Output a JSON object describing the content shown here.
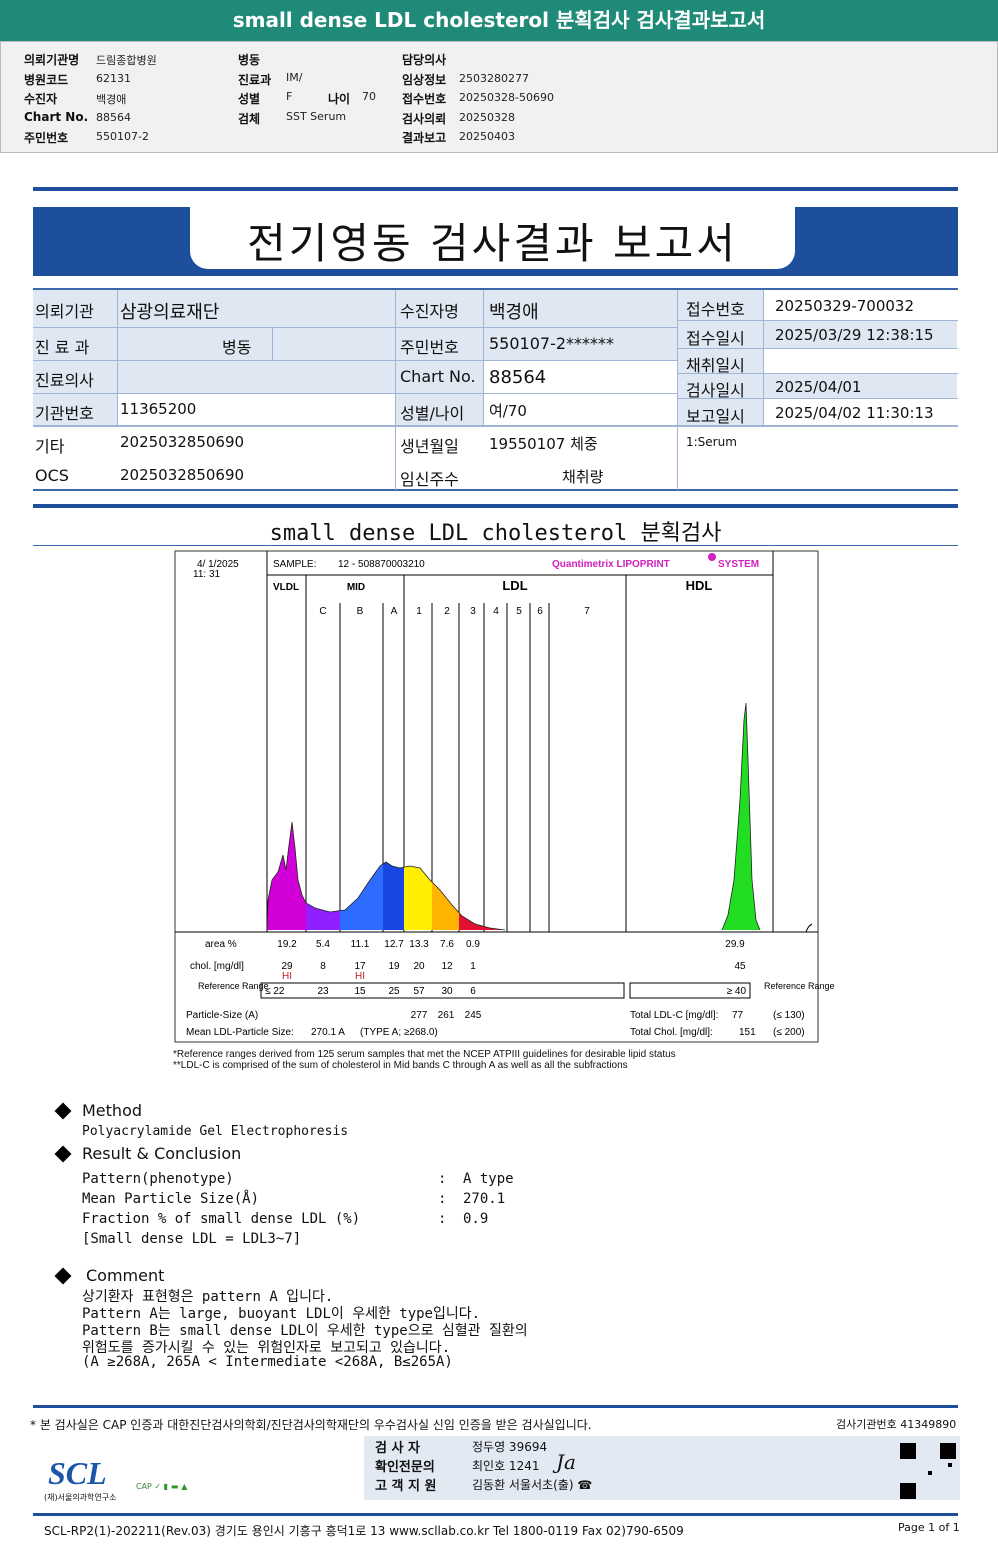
{
  "top_title": "small dense LDL cholesterol 분획검사 검사결과보고서",
  "header": {
    "col1": [
      {
        "k": "의뢰기관명",
        "v": "드림종합병원"
      },
      {
        "k": "병원코드",
        "v": "62131"
      },
      {
        "k": "수진자",
        "v": "백경애"
      },
      {
        "k": "Chart No.",
        "v": "88564"
      },
      {
        "k": "주민번호",
        "v": "550107-2"
      }
    ],
    "col2": [
      {
        "k": "병동",
        "v": ""
      },
      {
        "k": "진료과",
        "v": "IM/"
      },
      {
        "k": "성별",
        "v": "F"
      },
      {
        "k": "검체",
        "v": "SST Serum"
      }
    ],
    "age_label": "나이",
    "age": "70",
    "col3": [
      {
        "k": "담당의사",
        "v": ""
      },
      {
        "k": "임상정보",
        "v": "2503280277"
      },
      {
        "k": "접수번호",
        "v": "20250328-50690"
      },
      {
        "k": "검사의뢰",
        "v": "20250328"
      },
      {
        "k": "결과보고",
        "v": "20250403"
      }
    ]
  },
  "banner_title": "전기영동 검사결과 보고서",
  "info": {
    "l1": "의뢰기관",
    "v1": "삼광의료재단",
    "l2": "수진자명",
    "v2": "백경애",
    "l3": "진 료 과",
    "v3": "병동",
    "l4": "주민번호",
    "v4": "550107-2******",
    "l5": "진료의사",
    "v5": "",
    "l6": "Chart No.",
    "v6": "88564",
    "l7": "기관번호",
    "v7": "11365200",
    "l8": "성별/나이",
    "v8": "여/70",
    "l9": "기타",
    "v9": "2025032850690",
    "l10": "생년월일",
    "v10": "19550107 체중",
    "l11": "OCS",
    "v11": "2025032850690",
    "l12": "임신주수",
    "v12": "채취량",
    "r": [
      {
        "k": "접수번호",
        "v": "20250329-700032"
      },
      {
        "k": "접수일시",
        "v": "2025/03/29 12:38:15"
      },
      {
        "k": "채취일시",
        "v": ""
      },
      {
        "k": "검사일시",
        "v": "2025/04/01"
      },
      {
        "k": "보고일시",
        "v": "2025/04/02 11:30:13"
      }
    ],
    "specimen": "1:Serum"
  },
  "section_title": "small dense LDL cholesterol 분획검사",
  "chart_data": {
    "type": "area",
    "datetime": [
      "4/  1/2025",
      "11: 31"
    ],
    "sample_label": "SAMPLE:",
    "sample": "12 - 508870003210",
    "brand": "Quantimetrix LIPOPRINT",
    "brand_suffix": "SYSTEM",
    "groups": [
      "VLDL",
      "MID",
      "LDL",
      "HDL"
    ],
    "bands": [
      "C",
      "B",
      "A",
      "1",
      "2",
      "3",
      "4",
      "5",
      "6",
      "7"
    ],
    "colors": {
      "VLDL": "#d200d8",
      "C": "#9020ff",
      "B": "#2e6cff",
      "A": "#1846e0",
      "1": "#ffee00",
      "2": "#ffb400",
      "3": "#e0102e",
      "HDL": "#22dd22"
    },
    "area_label": "area %",
    "area": [
      "19.2",
      "5.4",
      "11.1",
      "12.7",
      "13.3",
      "7.6",
      "0.9"
    ],
    "hdl_area": "29.9",
    "chol_label": "chol. [mg/dl]",
    "chol": [
      "29",
      "8",
      "17",
      "19",
      "20",
      "12",
      "1"
    ],
    "hdl_chol": "45",
    "flags": [
      "HI",
      "",
      "HI",
      "",
      "",
      "",
      ""
    ],
    "ref_label": "Reference Range",
    "ref": [
      "≤ 22",
      "23",
      "15",
      "25",
      "57",
      "30",
      "6"
    ],
    "hdl_ref": "≥  40",
    "psize_label": "Particle-Size (A)",
    "psize": [
      "277",
      "261",
      "245"
    ],
    "mean_label": "Mean LDL-Particle Size:",
    "mean": "270.1  A",
    "mean_type": "(TYPE A; ≥268.0)",
    "tldl_label": "Total LDL-C  [mg/dl]:",
    "tldl": "77",
    "tldl_ref": "(≤ 130)",
    "tchol_label": "Total Chol.  [mg/dl]:",
    "tchol": "151",
    "tchol_ref": "(≤ 200)"
  },
  "notes": [
    "*Reference ranges derived from 125 serum samples that met the NCEP ATPIII guidelines for desirable lipid status",
    "**LDL-C is comprised of the sum of cholesterol in Mid bands C through A as well as all the subfractions"
  ],
  "method": {
    "title": "Method",
    "text": "Polyacrylamide Gel Electrophoresis"
  },
  "result": {
    "title": "Result & Conclusion",
    "rows": [
      {
        "k": "Pattern(phenotype)",
        "v": "A type"
      },
      {
        "k": "Mean Particle Size(Å)",
        "v": "270.1"
      },
      {
        "k": "Fraction % of small dense LDL (%)",
        "v": "0.9"
      }
    ],
    "note": "[Small dense LDL = LDL3~7]"
  },
  "comment": {
    "title": "Comment",
    "lines": [
      "상기환자 표현형은 pattern A 입니다.",
      "Pattern A는 large, buoyant LDL이 우세한 type입니다.",
      "Pattern B는 small dense LDL이 우세한 type으로 심혈관 질환의",
      "위험도를 증가시킬 수 있는 위험인자로 보고되고 있습니다.",
      "(A ≥268A, 265A < Intermediate <268A, B≤265A)"
    ]
  },
  "footer": {
    "cert": "* 본 검사실은 CAP 인증과 대한진단검사의학회/진단검사의학재단의 우수검사실 신임 인증을 받은 검사실입니다.",
    "lab_no": "검사기관번호  41349890",
    "staff": [
      {
        "k": "검   사   자",
        "v": "정두영 39694"
      },
      {
        "k": "확인전문의",
        "v": "최인호 1241"
      },
      {
        "k": "고 객 지 원",
        "v": "김동환 서울서초(출) ☎"
      }
    ],
    "logo": "SCL",
    "logo_sub": "(재)서울의과학연구소",
    "address": "SCL-RP2(1)-202211(Rev.03)  경기도 용인시 기흥구 흥덕1로 13   www.scllab.co.kr   Tel 1800-0119    Fax 02)790-6509",
    "page": "Page 1 of 1"
  }
}
